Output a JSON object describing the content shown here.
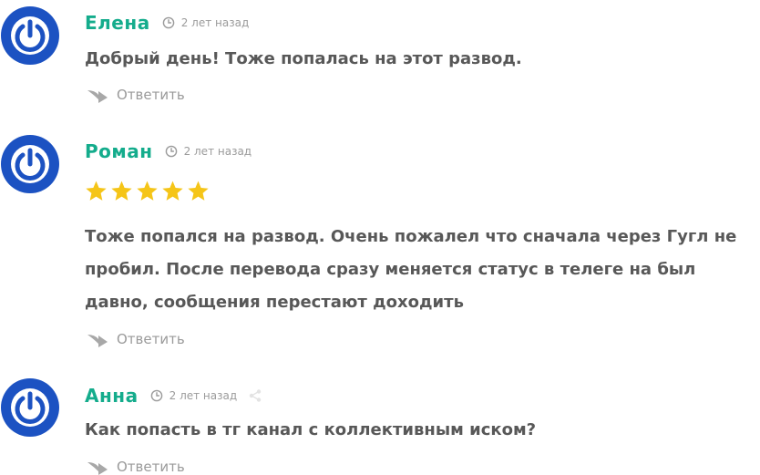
{
  "comments": [
    {
      "author": "Елена",
      "time": "2 лет назад",
      "text": "Добрый день! Тоже попалась на этот развод.",
      "reply_label": "Ответить"
    },
    {
      "author": "Роман",
      "time": "2 лет назад",
      "rating": 5,
      "rating_max": 5,
      "text_lines": [
        "Тоже попался на развод. Очень пожалел что сначала через Гугл не",
        "пробил. После перевода сразу меняется статус в телеге на был",
        "давно, сообщения перестают доходить"
      ],
      "reply_label": "Ответить"
    },
    {
      "author": "Анна",
      "time": "2 лет назад",
      "text": "Как попасть в тг канал с коллективным иском?",
      "reply_label": "Ответить"
    }
  ],
  "colors": {
    "author": "#14ac8c",
    "text": "#585858",
    "meta": "#9b9b9b",
    "star": "#f5c518",
    "avatar_ring": "#1c52c2"
  },
  "icons": {
    "avatar": "power-icon",
    "time": "clock-icon",
    "reply": "reply-arrow-icon",
    "share": "share-icon",
    "rating": "star-icon"
  }
}
